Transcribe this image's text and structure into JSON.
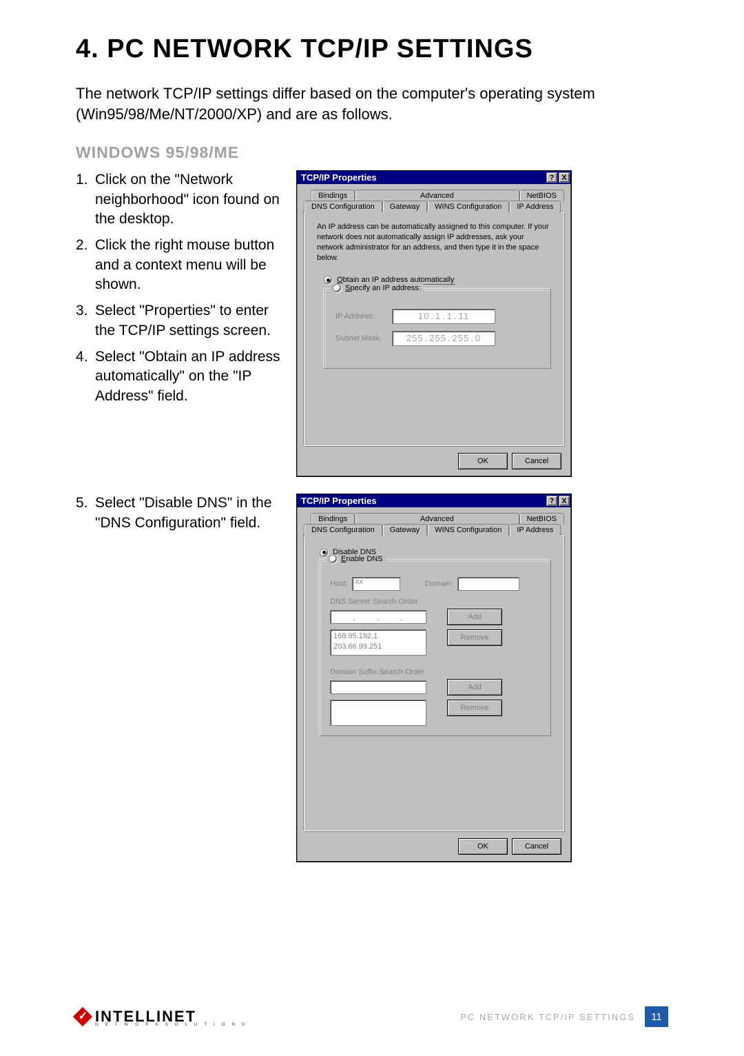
{
  "page": {
    "heading": "4. PC NETWORK TCP/IP SETTINGS",
    "intro": "The network TCP/IP settings differ based on the computer's operating system (Win95/98/Me/NT/2000/XP) and are as follows.",
    "subheading": "WINDOWS 95/98/ME",
    "footer_label": "PC NETWORK TCP/IP SETTINGS",
    "page_number": "11",
    "brand": "INTELLINET",
    "brand_tag": "N E T W O R K   S O L U T I O N S"
  },
  "steps_a": [
    "Click on the \"Network neighborhood\" icon found on the desktop.",
    "Click the right mouse button and a context menu will be shown.",
    "Select \"Properties\" to enter the TCP/IP settings screen.",
    "Select \"Obtain an IP address automatically\" on the \"IP Address\" field."
  ],
  "steps_b": [
    "Select \"Disable DNS\" in the \"DNS Configuration\" field."
  ],
  "dialog1": {
    "title": "TCP/IP Properties",
    "help": "?",
    "close": "X",
    "tabs_back": [
      "Bindings",
      "Advanced",
      "NetBIOS"
    ],
    "tabs_front": [
      "DNS Configuration",
      "Gateway",
      "WINS Configuration",
      "IP Address"
    ],
    "desc": "An IP address can be automatically assigned to this computer. If your network does not automatically assign IP addresses, ask your network administrator for an address, and then type it in the space below.",
    "radio_auto": "Obtain an IP address automatically",
    "radio_specify": "Specify an IP address:",
    "ip_label": "IP Address:",
    "mask_label": "Subnet Mask:",
    "ip_value": [
      "10",
      "1",
      "1",
      "11"
    ],
    "mask_value": [
      "255",
      "255",
      "255",
      "0"
    ],
    "ok": "OK",
    "cancel": "Cancel"
  },
  "dialog2": {
    "title": "TCP/IP Properties",
    "help": "?",
    "close": "X",
    "tabs_back": [
      "Bindings",
      "Advanced",
      "NetBIOS"
    ],
    "tabs_front": [
      "DNS Configuration",
      "Gateway",
      "WINS Configuration",
      "IP Address"
    ],
    "radio_disable": "Disable DNS",
    "radio_enable": "Enable DNS",
    "host_label": "Host:",
    "host_value": "xx",
    "domain_label": "Domain:",
    "dns_order_label": "DNS Server Search Order",
    "add": "Add",
    "remove": "Remove",
    "dns_list": "168.95.192.1\n203.66.99.251",
    "suffix_label": "Domain Suffix Search Order",
    "ok": "OK",
    "cancel": "Cancel"
  }
}
